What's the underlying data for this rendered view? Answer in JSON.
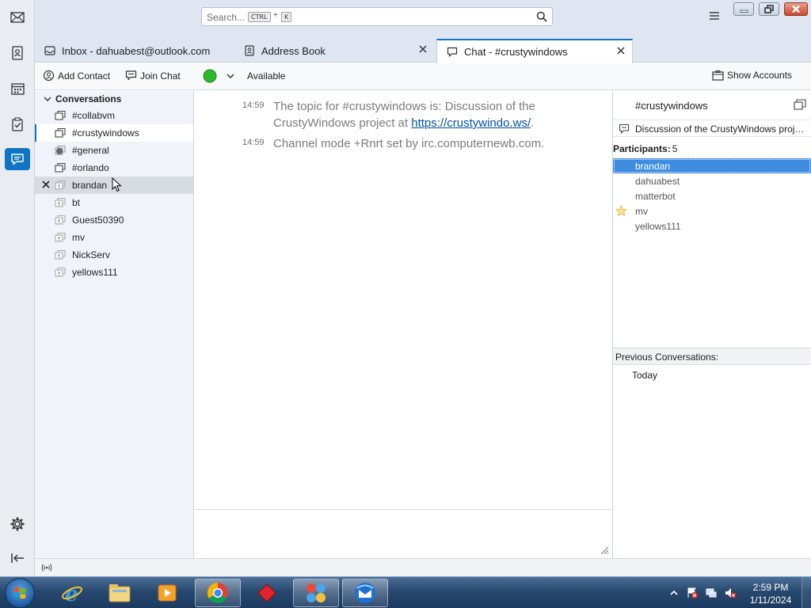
{
  "search": {
    "placeholder": "Search...",
    "kbd_ctrl": "CTRL",
    "kbd_plus": "+",
    "kbd_k": "K"
  },
  "tabs": [
    {
      "label": "Inbox - dahuabest@outlook.com",
      "icon": "inbox-icon"
    },
    {
      "label": "Address Book",
      "icon": "address-book-icon"
    },
    {
      "label": "Chat - #crustywindows",
      "icon": "chat-icon"
    }
  ],
  "toolbar": {
    "add_contact": "Add Contact",
    "join_chat": "Join Chat",
    "status": "Available",
    "status_color": "#2db82d",
    "show_accounts": "Show Accounts"
  },
  "conversations": {
    "header": "Conversations",
    "items": [
      {
        "label": "#collabvm",
        "icon": "channel-icon"
      },
      {
        "label": "#crustywindows",
        "icon": "channel-icon"
      },
      {
        "label": "#general",
        "icon": "channel-inactive-icon"
      },
      {
        "label": "#orlando",
        "icon": "channel-icon"
      },
      {
        "label": "brandan",
        "icon": "contact-icon"
      },
      {
        "label": "bt",
        "icon": "contact-icon"
      },
      {
        "label": "Guest50390",
        "icon": "contact-icon"
      },
      {
        "label": "mv",
        "icon": "contact-icon"
      },
      {
        "label": "NickServ",
        "icon": "contact-icon"
      },
      {
        "label": "yellows111",
        "icon": "contact-icon"
      }
    ]
  },
  "messages": [
    {
      "time": "14:59",
      "text_before": "The topic for #crustywindows is: Discussion of the CrustyWindows project at ",
      "link": "https://crustywindo.ws/",
      "text_after": "."
    },
    {
      "time": "14:59",
      "text_before": "Channel mode +Rnrt set by irc.computernewb.com.",
      "link": "",
      "text_after": ""
    }
  ],
  "panel": {
    "channel": "#crustywindows",
    "topic": "Discussion of the CrustyWindows project at https://crustywindo.ws/",
    "participants_label": "Participants:",
    "participants_count": "5",
    "participants": [
      {
        "name": "brandan"
      },
      {
        "name": "dahuabest"
      },
      {
        "name": "matterbot"
      },
      {
        "name": "mv"
      },
      {
        "name": "yellows111"
      }
    ],
    "previous_label": "Previous Conversations:",
    "previous_today": "Today"
  },
  "clock": {
    "time": "2:59 PM",
    "date": "1/11/2024"
  },
  "colors": {
    "accent": "#0f74c4",
    "link": "#0050a8",
    "selection": "#3e8de0"
  }
}
